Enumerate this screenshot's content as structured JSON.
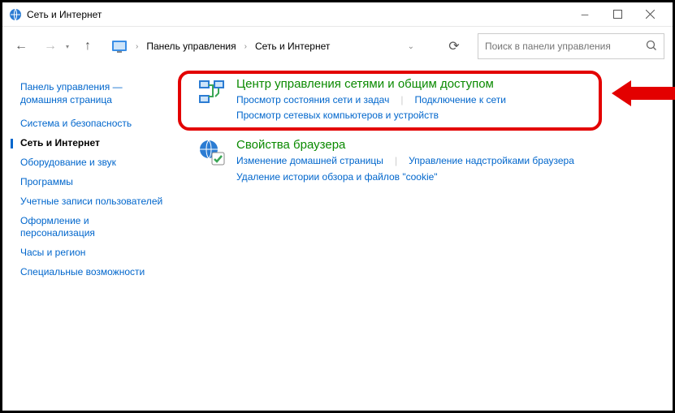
{
  "window": {
    "title": "Сеть и Интернет"
  },
  "breadcrumb": {
    "root": "Панель управления",
    "leaf": "Сеть и Интернет"
  },
  "search": {
    "placeholder": "Поиск в панели управления"
  },
  "sidebar": {
    "home": "Панель управления — домашняя страница",
    "items": [
      {
        "label": "Система и безопасность",
        "active": false
      },
      {
        "label": "Сеть и Интернет",
        "active": true
      },
      {
        "label": "Оборудование и звук",
        "active": false
      },
      {
        "label": "Программы",
        "active": false
      },
      {
        "label": "Учетные записи пользователей",
        "active": false
      },
      {
        "label": "Оформление и персонализация",
        "active": false
      },
      {
        "label": "Часы и регион",
        "active": false
      },
      {
        "label": "Специальные возможности",
        "active": false
      }
    ]
  },
  "categories": [
    {
      "title": "Центр управления сетями и общим доступом",
      "links": [
        "Просмотр состояния сети и задач",
        "Подключение к сети",
        "Просмотр сетевых компьютеров и устройств"
      ]
    },
    {
      "title": "Свойства браузера",
      "links": [
        "Изменение домашней страницы",
        "Управление надстройками браузера",
        "Удаление истории обзора и файлов \"cookie\""
      ]
    }
  ]
}
